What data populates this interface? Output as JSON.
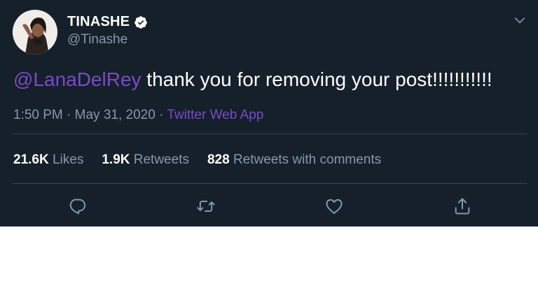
{
  "tweet": {
    "author": {
      "display_name": "TINASHE",
      "handle": "@Tinashe",
      "verified": true
    },
    "text": {
      "mention": "@LanaDelRey",
      "body": " thank you for removing your post!!!!!!!!!!!"
    },
    "meta": {
      "time": "1:50 PM",
      "separator1": " · ",
      "date": "May 31, 2020",
      "separator2": " · ",
      "source": "Twitter Web App"
    },
    "stats": {
      "likes": {
        "count": "21.6K",
        "label": " Likes"
      },
      "retweets": {
        "count": "1.9K",
        "label": " Retweets"
      },
      "quote_tweets": {
        "count": "828",
        "label": " Retweets with comments"
      }
    },
    "actions": [
      "reply-icon",
      "retweet-icon",
      "like-icon",
      "share-icon"
    ]
  },
  "colors": {
    "background": "#15202b",
    "text": "#ffffff",
    "secondary": "#8899a6",
    "accent": "#794bc4",
    "divider": "#38444d",
    "verified_badge": "#ffffff"
  }
}
